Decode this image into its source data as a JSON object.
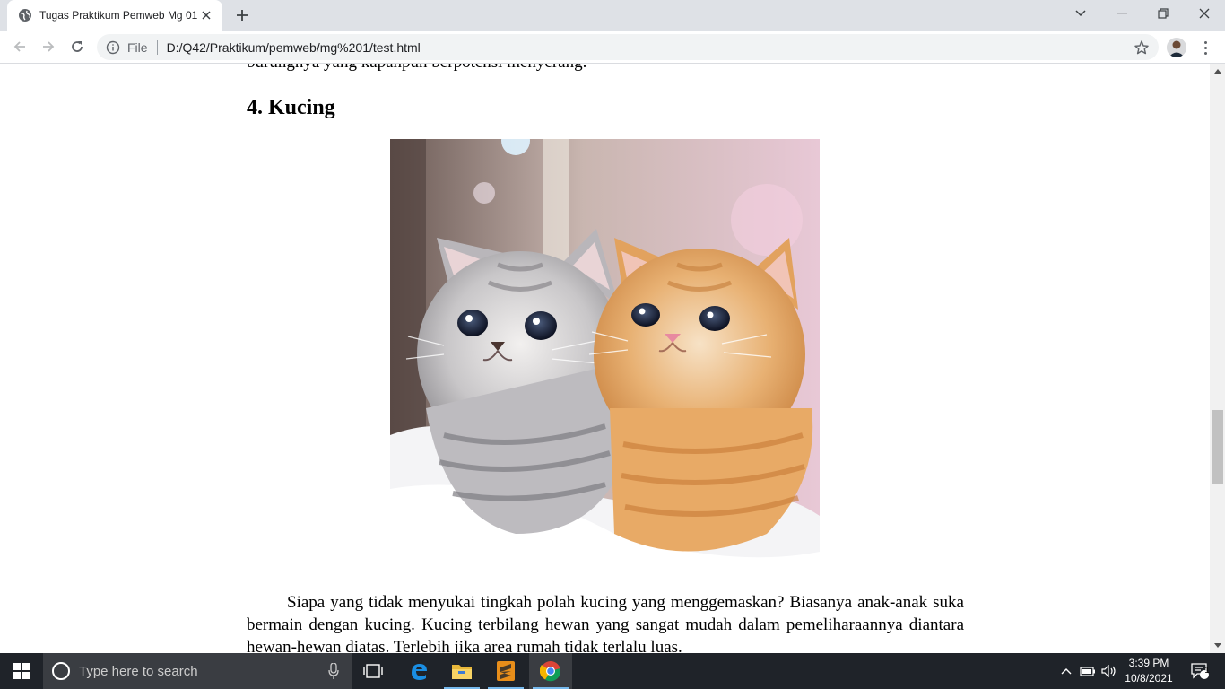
{
  "browser": {
    "tab_title": "Tugas Praktikum Pemweb Mg 01",
    "omnibox": {
      "file_label": "File",
      "url": "D:/Q42/Praktikum/pemweb/mg%201/test.html"
    }
  },
  "page": {
    "prev_text_partial": "burungnya yang kapanpun berpotensi menyerang.",
    "section_heading": "4. Kucing",
    "paragraph": "Siapa yang tidak menyukai tingkah polah kucing yang menggemaskan? Biasanya anak-anak suka bermain dengan kucing. Kucing terbilang hewan yang sangat mudah dalam pemeliharaannya diantara hewan-hewan diatas. Terlebih jika area rumah tidak terlalu luas."
  },
  "taskbar": {
    "search_placeholder": "Type here to search",
    "time": "3:39 PM",
    "date": "10/8/2021",
    "notification_count": "1"
  }
}
